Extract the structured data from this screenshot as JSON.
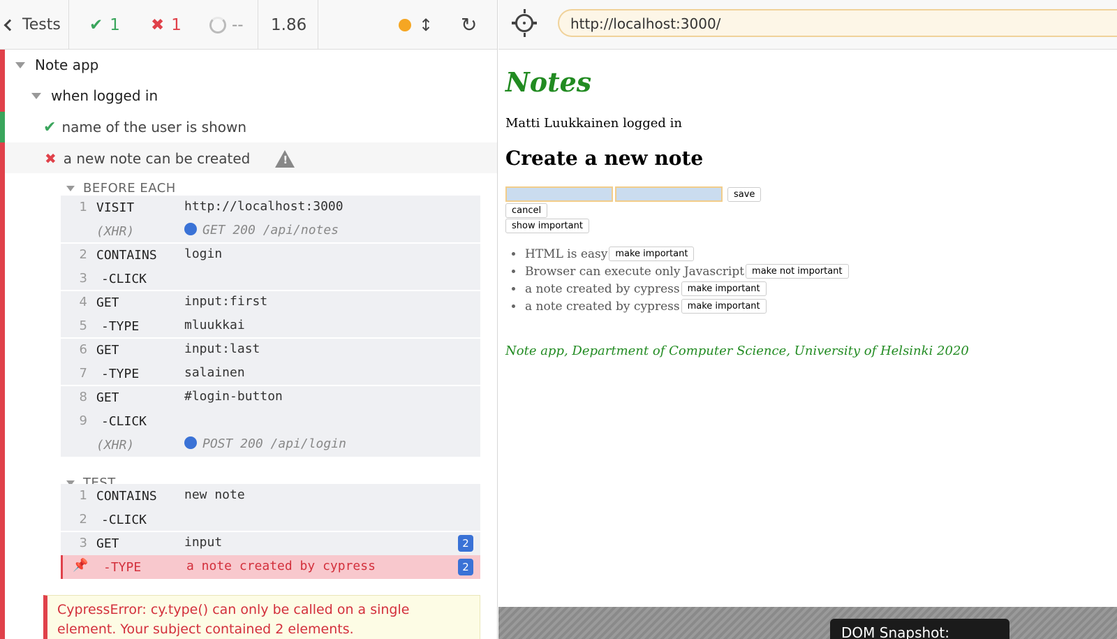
{
  "runner": {
    "tests_label": "Tests",
    "passed_count": "1",
    "failed_count": "1",
    "pending_count": "--",
    "duration": "1.86",
    "check_glyph": "✔",
    "cross_glyph": "✖",
    "updown_glyph": "↕",
    "reload_glyph": "↻"
  },
  "tree": {
    "suite": "Note app",
    "context": "when logged in",
    "passed_test": "name of the user is shown",
    "failed_test": "a new note can be created",
    "warn_glyph": "!"
  },
  "before_each": {
    "header": "BEFORE EACH",
    "commands": [
      {
        "num": "1",
        "name": "VISIT",
        "msg": "http://localhost:3000"
      },
      {
        "num": "",
        "name": "(XHR)",
        "msg": "GET 200 /api/notes"
      },
      {
        "num": "2",
        "name": "CONTAINS",
        "msg": "login"
      },
      {
        "num": "3",
        "name": "-CLICK",
        "msg": ""
      },
      {
        "num": "4",
        "name": "GET",
        "msg": "input:first"
      },
      {
        "num": "5",
        "name": "-TYPE",
        "msg": "mluukkai"
      },
      {
        "num": "6",
        "name": "GET",
        "msg": "input:last"
      },
      {
        "num": "7",
        "name": "-TYPE",
        "msg": "salainen"
      },
      {
        "num": "8",
        "name": "GET",
        "msg": "#login-button"
      },
      {
        "num": "9",
        "name": "-CLICK",
        "msg": ""
      },
      {
        "num": "",
        "name": "(XHR)",
        "msg": "POST 200 /api/login"
      }
    ]
  },
  "test": {
    "header": "TEST",
    "commands": [
      {
        "num": "1",
        "name": "CONTAINS",
        "msg": "new note",
        "badge": ""
      },
      {
        "num": "2",
        "name": "-CLICK",
        "msg": "",
        "badge": ""
      },
      {
        "num": "3",
        "name": "GET",
        "msg": "input",
        "badge": "2"
      },
      {
        "num": "",
        "name": "-TYPE",
        "msg": "a note created by cypress",
        "badge": "2"
      }
    ],
    "error": "CypressError: cy.type() can only be called on a single element. Your subject contained 2 elements."
  },
  "browser": {
    "url": "http://localhost:3000/"
  },
  "app": {
    "title": "Notes",
    "logged_in": "Matti Luukkainen logged in",
    "create_heading": "Create a new note",
    "save": "save",
    "cancel": "cancel",
    "show_important": "show important",
    "notes": [
      {
        "content": "HTML is easy",
        "button": "make important"
      },
      {
        "content": "Browser can execute only Javascript",
        "button": "make not important"
      },
      {
        "content": "a note created by cypress",
        "button": "make important"
      },
      {
        "content": "a note created by cypress",
        "button": "make important"
      }
    ],
    "footer": "Note app, Department of Computer Science, University of Helsinki 2020"
  },
  "snapshot": {
    "label": "DOM Snapshot:",
    "state": "before"
  },
  "colors": {
    "pass": "#3aa55c",
    "fail": "#e0414a",
    "xhr_dot": "#3a72d6",
    "app_green": "#228b22"
  }
}
